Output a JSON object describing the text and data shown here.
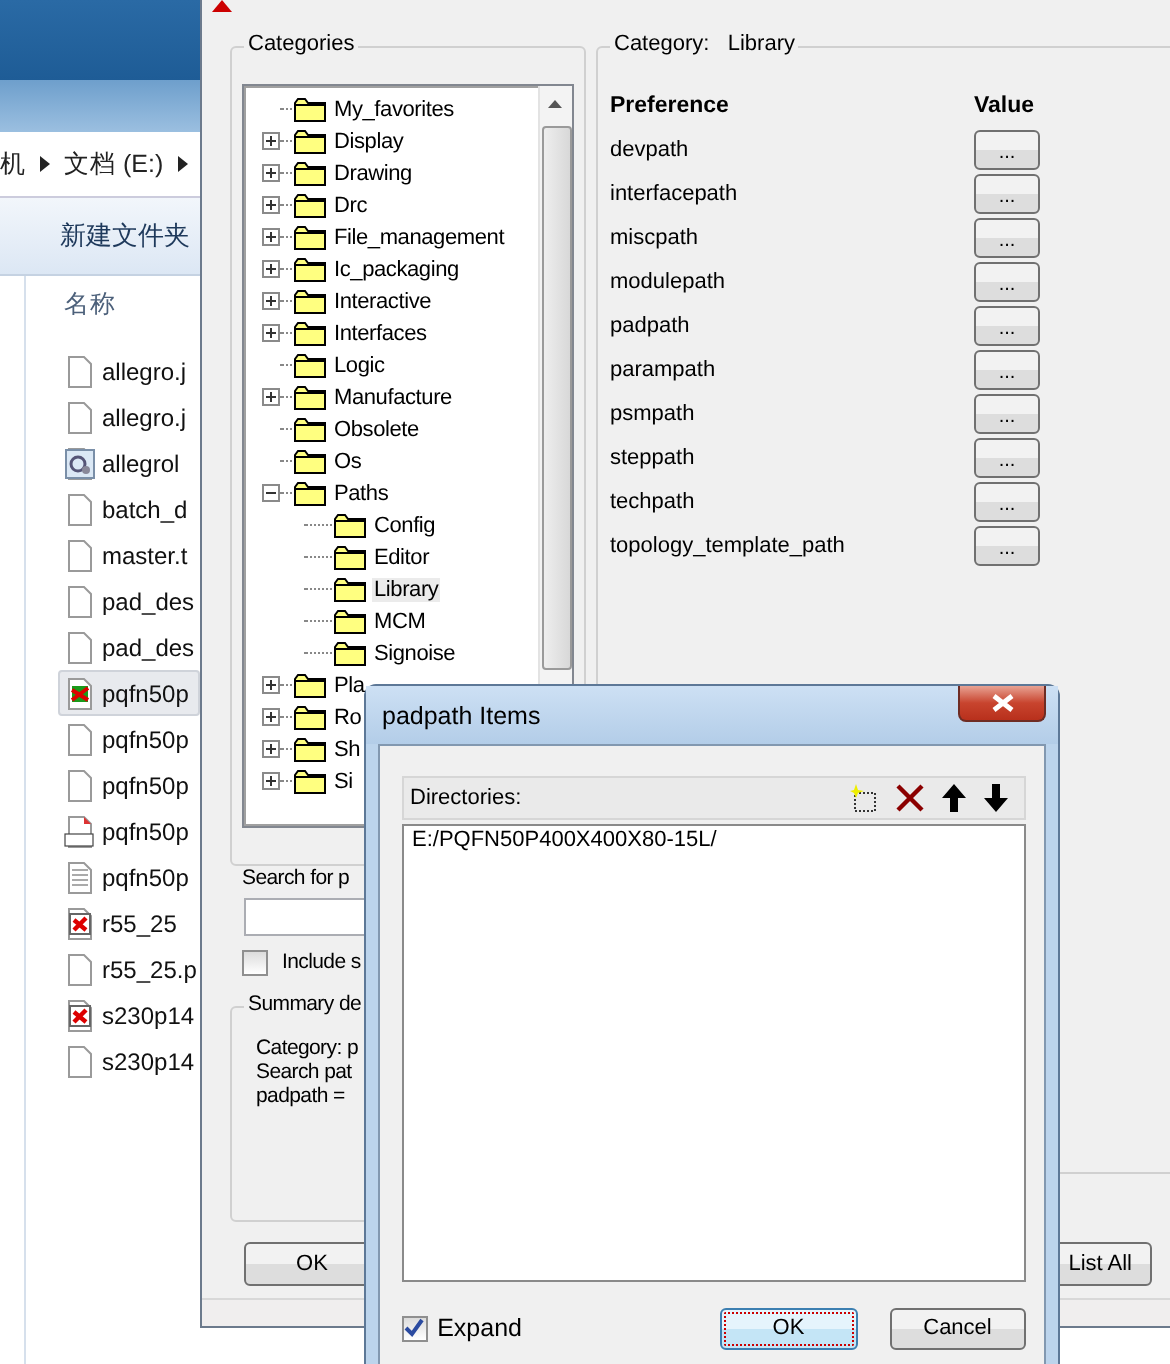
{
  "explorer": {
    "breadcrumb": [
      "机",
      "文档 (E:)"
    ],
    "toolbar_button": "新建文件夹",
    "column": "名称",
    "files": [
      {
        "name": "allegro.j",
        "kind": "blank",
        "selected": false
      },
      {
        "name": "allegro.j",
        "kind": "blank",
        "selected": false
      },
      {
        "name": "allegrol",
        "kind": "settings",
        "selected": false
      },
      {
        "name": "batch_d",
        "kind": "blank",
        "selected": false
      },
      {
        "name": "master.t",
        "kind": "blank",
        "selected": false
      },
      {
        "name": "pad_des",
        "kind": "blank",
        "selected": false
      },
      {
        "name": "pad_des",
        "kind": "blank",
        "selected": false
      },
      {
        "name": "pqfn50p",
        "kind": "layout",
        "selected": true
      },
      {
        "name": "pqfn50p",
        "kind": "blank",
        "selected": false
      },
      {
        "name": "pqfn50p",
        "kind": "blank",
        "selected": false
      },
      {
        "name": "pqfn50p",
        "kind": "script",
        "selected": false
      },
      {
        "name": "pqfn50p",
        "kind": "text",
        "selected": false
      },
      {
        "name": "r55_25",
        "kind": "board",
        "selected": false
      },
      {
        "name": "r55_25.p",
        "kind": "blank",
        "selected": false
      },
      {
        "name": "s230p14",
        "kind": "board",
        "selected": false
      },
      {
        "name": "s230p14",
        "kind": "blank",
        "selected": false
      }
    ]
  },
  "preferences": {
    "categories_label": "Categories",
    "tree": [
      {
        "label": "My_favorites",
        "kind": "leaf",
        "selected": false
      },
      {
        "label": "Display",
        "kind": "group",
        "expanded": false,
        "selected": false
      },
      {
        "label": "Drawing",
        "kind": "group",
        "expanded": false,
        "selected": false
      },
      {
        "label": "Drc",
        "kind": "group",
        "expanded": false,
        "selected": false
      },
      {
        "label": "File_management",
        "kind": "group",
        "expanded": false,
        "selected": false
      },
      {
        "label": "Ic_packaging",
        "kind": "group",
        "expanded": false,
        "selected": false
      },
      {
        "label": "Interactive",
        "kind": "group",
        "expanded": false,
        "selected": false
      },
      {
        "label": "Interfaces",
        "kind": "group",
        "expanded": false,
        "selected": false
      },
      {
        "label": "Logic",
        "kind": "leaf",
        "selected": false
      },
      {
        "label": "Manufacture",
        "kind": "group",
        "expanded": false,
        "selected": false
      },
      {
        "label": "Obsolete",
        "kind": "leaf",
        "selected": false
      },
      {
        "label": "Os",
        "kind": "leaf",
        "selected": false
      },
      {
        "label": "Paths",
        "kind": "group",
        "expanded": true,
        "selected": false,
        "children": [
          {
            "label": "Config",
            "selected": false
          },
          {
            "label": "Editor",
            "selected": false
          },
          {
            "label": "Library",
            "selected": true
          },
          {
            "label": "MCM",
            "selected": false
          },
          {
            "label": "Signoise",
            "selected": false
          }
        ]
      },
      {
        "label": "Pla",
        "kind": "group",
        "expanded": false,
        "selected": false
      },
      {
        "label": "Ro",
        "kind": "group",
        "expanded": false,
        "selected": false
      },
      {
        "label": "Sh",
        "kind": "group",
        "expanded": false,
        "selected": false
      },
      {
        "label": "Si",
        "kind": "group",
        "expanded": false,
        "selected": false
      }
    ],
    "category_label": "Category:",
    "category_value": "Library",
    "columns": [
      "Preference",
      "Value"
    ],
    "rows": [
      {
        "name": "devpath",
        "button": "..."
      },
      {
        "name": "interfacepath",
        "button": "..."
      },
      {
        "name": "miscpath",
        "button": "..."
      },
      {
        "name": "modulepath",
        "button": "..."
      },
      {
        "name": "padpath",
        "button": "..."
      },
      {
        "name": "parampath",
        "button": "..."
      },
      {
        "name": "psmpath",
        "button": "..."
      },
      {
        "name": "steppath",
        "button": "..."
      },
      {
        "name": "techpath",
        "button": "..."
      },
      {
        "name": "topology_template_path",
        "button": "..."
      }
    ],
    "search_label": "Search for p",
    "include": {
      "label": "Include s",
      "checked": false
    },
    "summary_title": "Summary de",
    "summary_lines": [
      "Category: p",
      "Search pat",
      "padpath ="
    ],
    "buttons": [
      "OK",
      "List All"
    ]
  },
  "dialog": {
    "title": "padpath Items",
    "directories_label": "Directories:",
    "entries": [
      "E:/PQFN50P400X400X80-15L/"
    ],
    "expand": {
      "label": "Expand",
      "checked": true
    },
    "buttons": [
      {
        "label": "OK",
        "default": true
      },
      {
        "label": "Cancel",
        "default": false
      }
    ]
  }
}
